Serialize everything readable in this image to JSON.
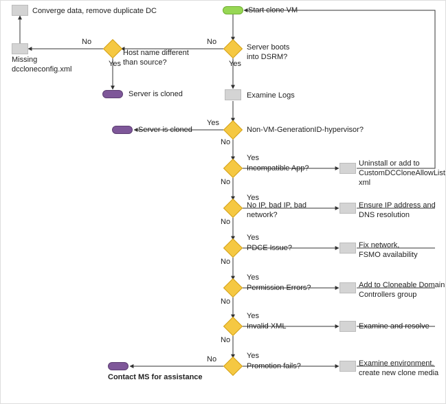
{
  "chart_data": {
    "type": "flowchart",
    "nodes": [
      {
        "id": "start",
        "kind": "start",
        "label": "Start clone VM"
      },
      {
        "id": "d_dsrm",
        "kind": "decision",
        "label": "Server boots\ninto DSRM?"
      },
      {
        "id": "p_logs",
        "kind": "process",
        "label": "Examine Logs"
      },
      {
        "id": "d_genid",
        "kind": "decision",
        "label": "Non-VM-GenerationID-hypervisor?"
      },
      {
        "id": "e_cloned2",
        "kind": "end",
        "label": "Server is cloned"
      },
      {
        "id": "d_app",
        "kind": "decision",
        "label": "Incompatible App?"
      },
      {
        "id": "p_app",
        "kind": "process",
        "label": "Uninstall or add to\nCustomDCCloneAllowList.\nxml"
      },
      {
        "id": "d_ip",
        "kind": "decision",
        "label": "No IP, bad IP, bad\nnetwork?"
      },
      {
        "id": "p_ip",
        "kind": "process",
        "label": "Ensure IP address and\nDNS resolution"
      },
      {
        "id": "d_pdce",
        "kind": "decision",
        "label": "PDCE Issue?"
      },
      {
        "id": "p_pdce",
        "kind": "process",
        "label": "Fix network,\nFSMO availability"
      },
      {
        "id": "d_perm",
        "kind": "decision",
        "label": "Permission Errors?"
      },
      {
        "id": "p_perm",
        "kind": "process",
        "label": "Add to Cloneable Domain\nControllers group"
      },
      {
        "id": "d_xml",
        "kind": "decision",
        "label": "Invalid XML"
      },
      {
        "id": "p_xml",
        "kind": "process",
        "label": "Examine and resolve"
      },
      {
        "id": "d_promo",
        "kind": "decision",
        "label": "Promotion fails?"
      },
      {
        "id": "p_promo",
        "kind": "process",
        "label": "Examine environment,\ncreate new clone media"
      },
      {
        "id": "e_contact",
        "kind": "end",
        "label": "Contact MS for assistance"
      },
      {
        "id": "d_host",
        "kind": "decision",
        "label": "Host name different\nthan source?"
      },
      {
        "id": "e_cloned1",
        "kind": "end",
        "label": "Server is cloned"
      },
      {
        "id": "p_missing",
        "kind": "process",
        "label": "Missing\ndccloneconfig.xml"
      },
      {
        "id": "p_converge",
        "kind": "process",
        "label": "Converge data, remove duplicate DC"
      }
    ],
    "edges": [
      {
        "from": "start",
        "to": "d_dsrm"
      },
      {
        "from": "d_dsrm",
        "to": "p_logs",
        "label": "Yes"
      },
      {
        "from": "d_dsrm",
        "to": "d_host",
        "label": "No"
      },
      {
        "from": "p_logs",
        "to": "d_genid"
      },
      {
        "from": "d_genid",
        "to": "e_cloned2",
        "label": "Yes"
      },
      {
        "from": "d_genid",
        "to": "d_app",
        "label": "No"
      },
      {
        "from": "d_app",
        "to": "p_app",
        "label": "Yes"
      },
      {
        "from": "d_app",
        "to": "d_ip",
        "label": "No"
      },
      {
        "from": "d_ip",
        "to": "p_ip",
        "label": "Yes"
      },
      {
        "from": "d_ip",
        "to": "d_pdce",
        "label": "No"
      },
      {
        "from": "d_pdce",
        "to": "p_pdce",
        "label": "Yes"
      },
      {
        "from": "d_pdce",
        "to": "d_perm",
        "label": "No"
      },
      {
        "from": "d_perm",
        "to": "p_perm",
        "label": "Yes"
      },
      {
        "from": "d_perm",
        "to": "d_xml",
        "label": "No"
      },
      {
        "from": "d_xml",
        "to": "p_xml",
        "label": "Yes"
      },
      {
        "from": "d_xml",
        "to": "d_promo",
        "label": "No"
      },
      {
        "from": "d_promo",
        "to": "p_promo",
        "label": "Yes"
      },
      {
        "from": "d_promo",
        "to": "e_contact",
        "label": "No"
      },
      {
        "from": "p_app",
        "to": "start"
      },
      {
        "from": "p_ip",
        "to": "start"
      },
      {
        "from": "p_pdce",
        "to": "start"
      },
      {
        "from": "p_perm",
        "to": "start"
      },
      {
        "from": "p_xml",
        "to": "start"
      },
      {
        "from": "p_promo",
        "to": "start"
      },
      {
        "from": "d_host",
        "to": "e_cloned1",
        "label": "Yes"
      },
      {
        "from": "d_host",
        "to": "p_missing",
        "label": "No"
      },
      {
        "from": "p_missing",
        "to": "p_converge"
      }
    ]
  },
  "labels": {
    "yes": "Yes",
    "no": "No"
  }
}
